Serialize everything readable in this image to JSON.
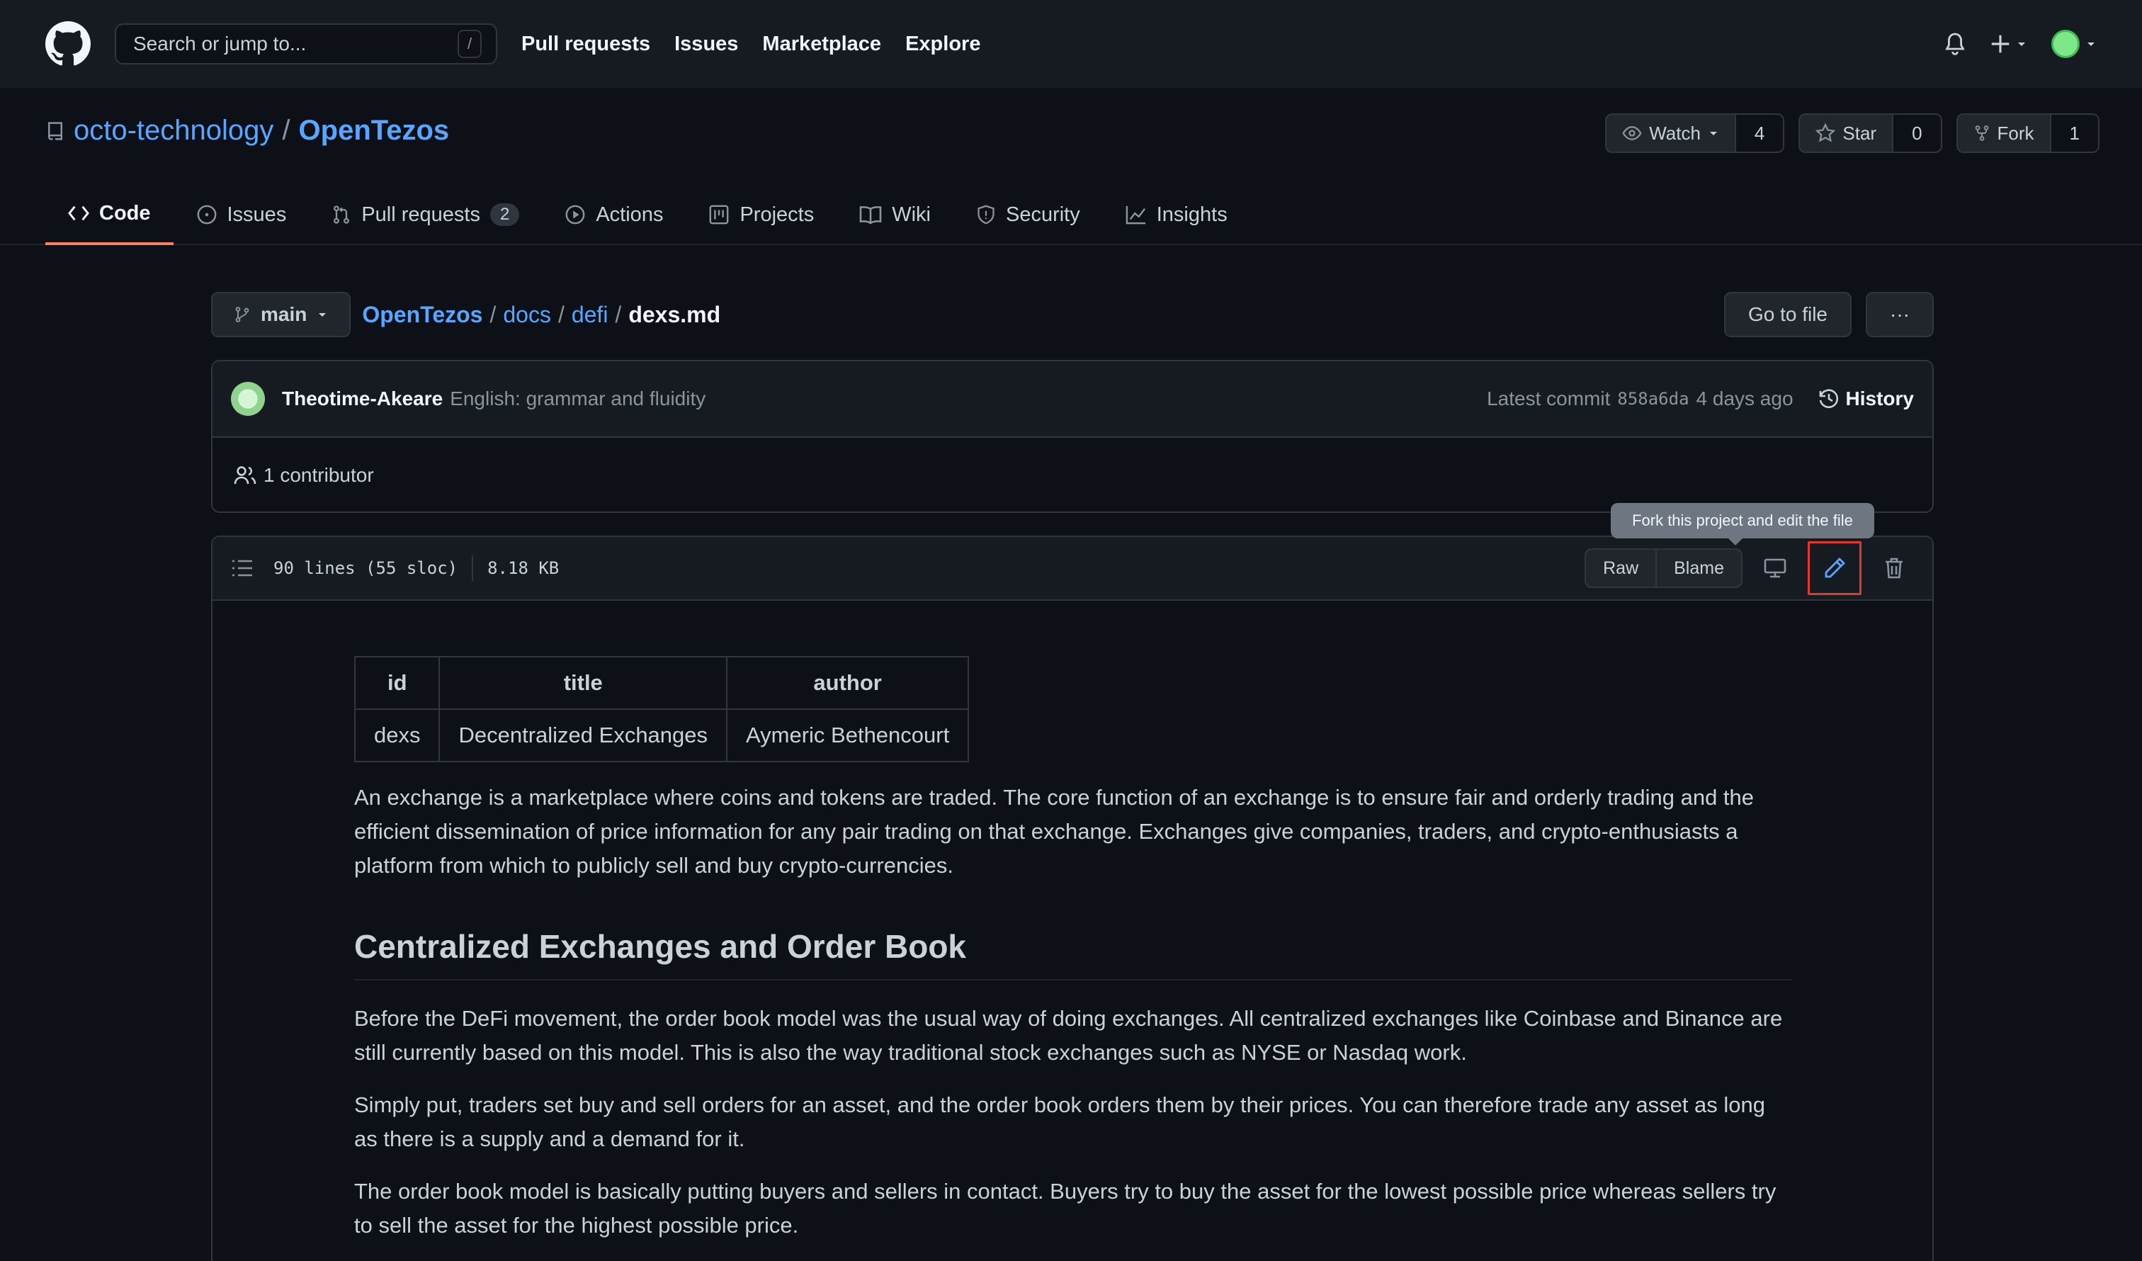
{
  "header": {
    "search_placeholder": "Search or jump to...",
    "search_shortcut": "/",
    "nav": [
      "Pull requests",
      "Issues",
      "Marketplace",
      "Explore"
    ]
  },
  "repo": {
    "owner": "octo-technology",
    "separator": "/",
    "name": "OpenTezos",
    "watch_label": "Watch",
    "watch_count": "4",
    "star_label": "Star",
    "star_count": "0",
    "fork_label": "Fork",
    "fork_count": "1"
  },
  "tabs": [
    {
      "label": "Code",
      "icon": "code-icon",
      "active": true
    },
    {
      "label": "Issues",
      "icon": "issue-icon"
    },
    {
      "label": "Pull requests",
      "icon": "pull-request-icon",
      "counter": "2"
    },
    {
      "label": "Actions",
      "icon": "play-icon"
    },
    {
      "label": "Projects",
      "icon": "project-icon"
    },
    {
      "label": "Wiki",
      "icon": "book-icon"
    },
    {
      "label": "Security",
      "icon": "shield-icon"
    },
    {
      "label": "Insights",
      "icon": "graph-icon"
    }
  ],
  "path": {
    "branch": "main",
    "root": "OpenTezos",
    "seg1": "docs",
    "seg2": "defi",
    "file": "dexs.md",
    "sep": "/",
    "go_to_file": "Go to file",
    "more": "···"
  },
  "commit": {
    "author": "Theotime-Akeare",
    "message": "English: grammar and fluidity",
    "latest_label": "Latest commit",
    "sha": "858a6da",
    "time": "4 days ago",
    "history_label": "History",
    "contributors": "1 contributor"
  },
  "file": {
    "lines": "90 lines (55 sloc)",
    "size": "8.18 KB",
    "raw_label": "Raw",
    "blame_label": "Blame",
    "tooltip": "Fork this project and edit the file"
  },
  "content": {
    "table": {
      "headers": [
        "id",
        "title",
        "author"
      ],
      "row": [
        "dexs",
        "Decentralized Exchanges",
        "Aymeric Bethencourt"
      ]
    },
    "p1": "An exchange is a marketplace where coins and tokens are traded. The core function of an exchange is to ensure fair and orderly trading and the efficient dissemination of price information for any pair trading on that exchange. Exchanges give companies, traders, and crypto-enthusiasts a platform from which to publicly sell and buy crypto-currencies.",
    "h2": "Centralized Exchanges and Order Book",
    "p2": "Before the DeFi movement, the order book model was the usual way of doing exchanges. All centralized exchanges like Coinbase and Binance are still currently based on this model. This is also the way traditional stock exchanges such as NYSE or Nasdaq work.",
    "p3": "Simply put, traders set buy and sell orders for an asset, and the order book orders them by their prices. You can therefore trade any asset as long as there is a supply and a demand for it.",
    "p4": "The order book model is basically putting buyers and sellers in contact. Buyers try to buy the asset for the lowest possible price whereas sellers try to sell the asset for the highest possible price."
  }
}
